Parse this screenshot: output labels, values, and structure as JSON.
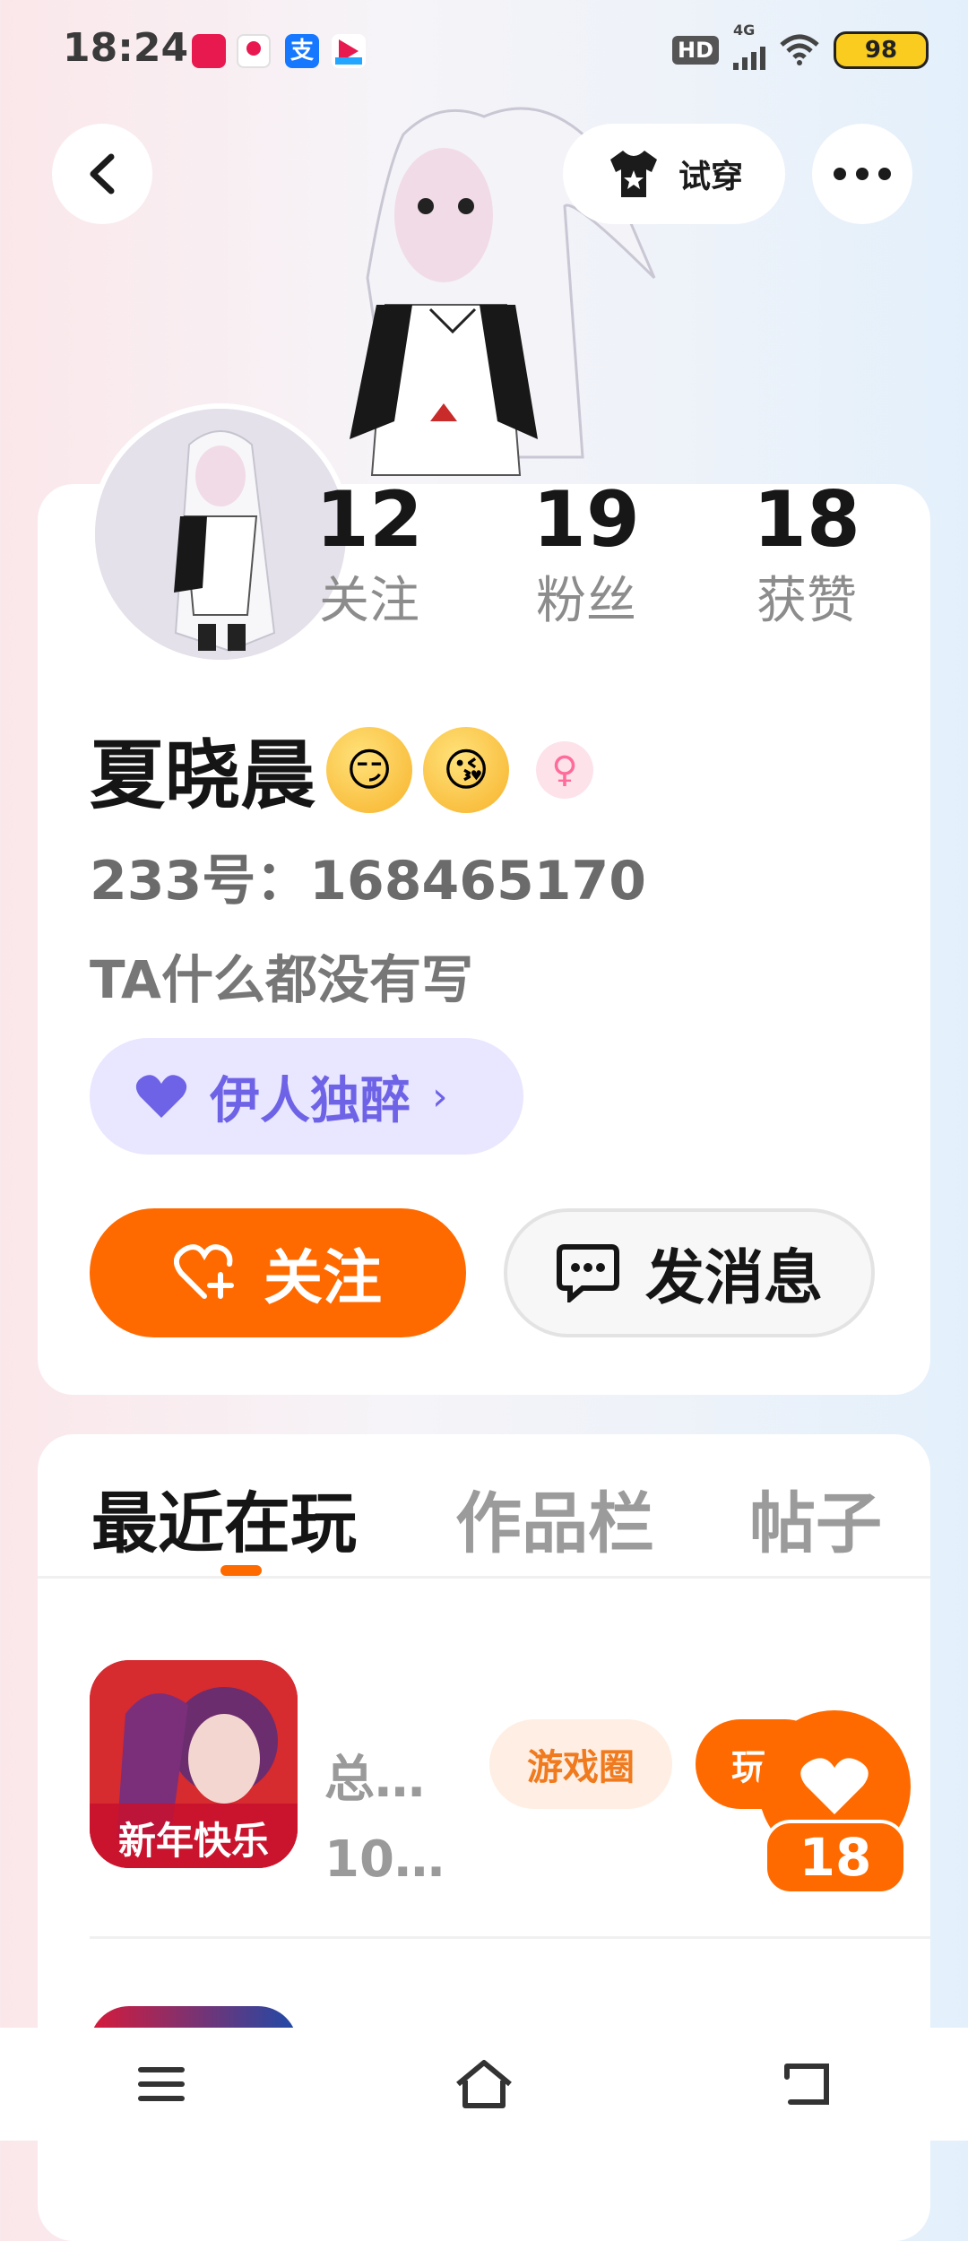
{
  "status_bar": {
    "time": "18:24",
    "apps": [
      "app-icon-red",
      "map-pin-icon",
      "alipay-icon",
      "blue-app-icon"
    ],
    "hd": "HD",
    "network": "4G",
    "battery": "98"
  },
  "header": {
    "tryon_label": "试穿"
  },
  "stats": [
    {
      "value": "12",
      "label": "关注"
    },
    {
      "value": "19",
      "label": "粉丝"
    },
    {
      "value": "18",
      "label": "获赞"
    }
  ],
  "profile": {
    "name": "夏晓晨",
    "emoji1": "😏",
    "emoji2": "😘",
    "uid": "233号：168465170",
    "bio": "TA什么都没有写",
    "fan_badge": "伊人独醉"
  },
  "actions": {
    "follow_label": "关注",
    "message_label": "发消息"
  },
  "tabs": [
    "最近在玩",
    "作品栏",
    "帖子"
  ],
  "game": {
    "icon_text": "新年快乐",
    "title": "总…",
    "subtitle": "10…",
    "circle_chip": "游戏圈",
    "play_chip": "玩",
    "likes": "18"
  },
  "colors": {
    "accent": "#ff6a00",
    "fan_purple": "#6e63e6"
  }
}
